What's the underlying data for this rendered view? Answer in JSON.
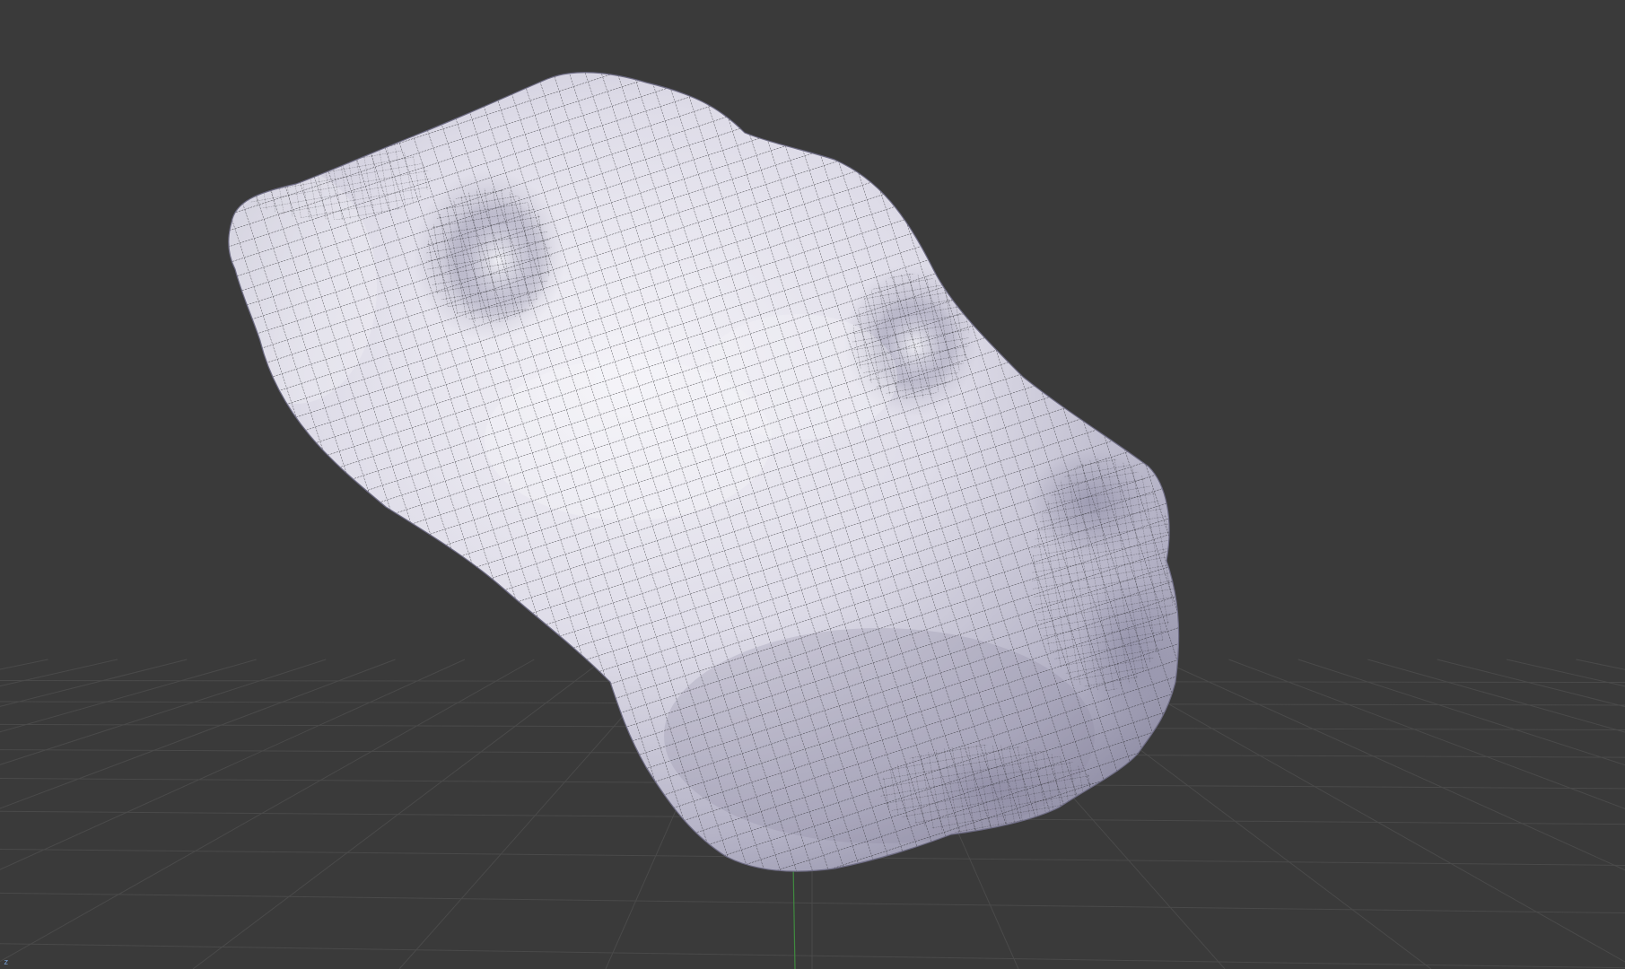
{
  "viewport": {
    "background_color": "#3a3a3a",
    "grid_color": "#4a4a4a",
    "mesh_base_color": "#c8c6d4",
    "mesh_highlight_color": "#f4f3f8",
    "mesh_shadow_color": "#8a88a0",
    "wire_color": "#2a2a2e",
    "y_axis_color": "#3f8a3f",
    "axis_label": "z"
  }
}
